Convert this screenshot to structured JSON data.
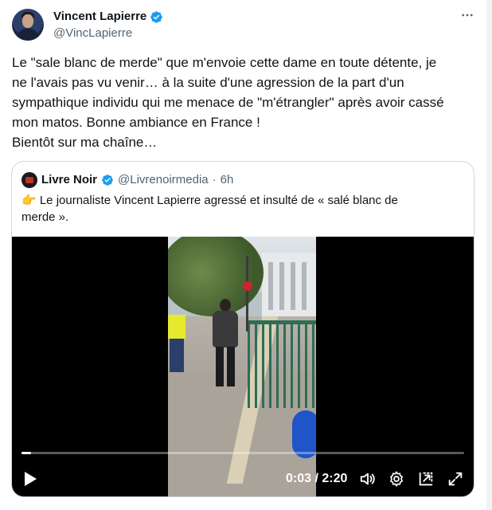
{
  "author": {
    "display_name": "Vincent Lapierre",
    "handle": "@VincLapierre"
  },
  "tweet": {
    "text": "Le  \"sale blanc de merde\" que m'envoie cette dame en toute détente, je\nne l'avais pas vu venir… à la suite d'une agression de la part d'un\nsympathique individu qui me menace de \"m'étrangler\" après avoir cassé\nmon matos. Bonne ambiance en France !\nBientôt sur ma chaîne…"
  },
  "quote": {
    "display_name": "Livre Noir",
    "handle": "@Livrenoirmedia",
    "separator": "·",
    "time": "6h",
    "text": "👉 Le journaliste Vincent Lapierre agressé et insulté de « salé blanc de\nmerde »."
  },
  "video": {
    "time_label": "0:03 / 2:20",
    "progress_fraction": 0.021,
    "controls": [
      "play-icon",
      "volume-icon",
      "settings-icon",
      "pop-out-icon",
      "fullscreen-icon"
    ]
  },
  "colors": {
    "verified_blue": "#1d9bf0",
    "text_primary": "#0f1419",
    "text_secondary": "#536471",
    "border": "#cfd9de"
  },
  "icons": {
    "more": "more-options-icon",
    "verified": "verified-badge-icon"
  }
}
